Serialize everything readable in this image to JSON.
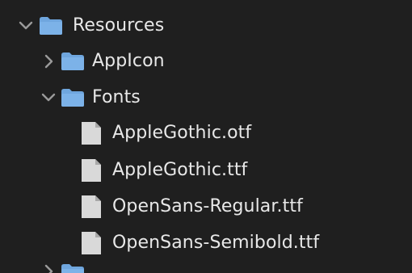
{
  "tree": {
    "items": [
      {
        "label": "Resources",
        "kind": "folder",
        "state": "expanded",
        "level": 0
      },
      {
        "label": "AppIcon",
        "kind": "folder",
        "state": "collapsed",
        "level": 1
      },
      {
        "label": "Fonts",
        "kind": "folder",
        "state": "expanded",
        "level": 1
      },
      {
        "label": "AppleGothic.otf",
        "kind": "file",
        "level": 2
      },
      {
        "label": "AppleGothic.ttf",
        "kind": "file",
        "level": 2
      },
      {
        "label": "OpenSans-Regular.ttf",
        "kind": "file",
        "level": 2
      },
      {
        "label": "OpenSans-Semibold.ttf",
        "kind": "file",
        "level": 2
      }
    ]
  },
  "colors": {
    "background": "#1f1f1f",
    "folder": "#6fa6de",
    "file": "#d9d9d9",
    "chevron": "#9a9a9a",
    "text": "#e8e8e8"
  }
}
